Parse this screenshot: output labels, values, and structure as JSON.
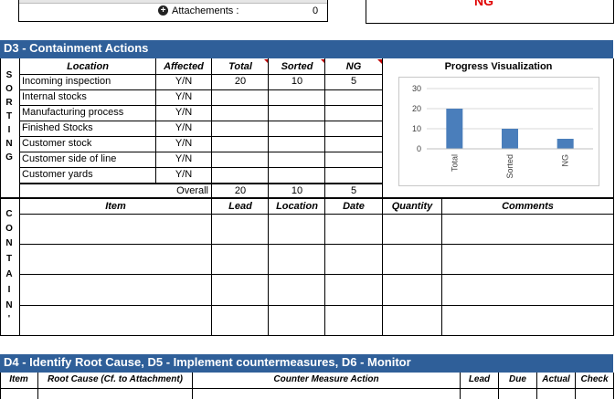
{
  "top": {
    "attachments_label": "Attachements :",
    "attachments_value": "0",
    "ng_label": "NG",
    "ng_color": "#e00000"
  },
  "d3": {
    "title": "D3 - Containment Actions",
    "sorting_letters": [
      "S",
      "O",
      "R",
      "T",
      "I",
      "N",
      "G"
    ],
    "headers": {
      "location": "Location",
      "affected": "Affected",
      "total": "Total",
      "sorted": "Sorted",
      "ng": "NG",
      "progress": "Progress Visualization"
    },
    "rows": [
      {
        "location": "Incoming inspection",
        "affected": "Y/N",
        "total": "20",
        "sorted": "10",
        "ng": "5"
      },
      {
        "location": "Internal stocks",
        "affected": "Y/N",
        "total": "",
        "sorted": "",
        "ng": ""
      },
      {
        "location": "Manufacturing process",
        "affected": "Y/N",
        "total": "",
        "sorted": "",
        "ng": ""
      },
      {
        "location": "Finished Stocks",
        "affected": "Y/N",
        "total": "",
        "sorted": "",
        "ng": ""
      },
      {
        "location": "Customer stock",
        "affected": "Y/N",
        "total": "",
        "sorted": "",
        "ng": ""
      },
      {
        "location": "Customer side of line",
        "affected": "Y/N",
        "total": "",
        "sorted": "",
        "ng": ""
      },
      {
        "location": "Customer yards",
        "affected": "Y/N",
        "total": "",
        "sorted": "",
        "ng": ""
      }
    ],
    "overall": {
      "label": "Overall",
      "total": "20",
      "sorted": "10",
      "ng": "5"
    },
    "contain_letters": [
      "C",
      "O",
      "N",
      "T",
      "A",
      "I",
      "N",
      "'"
    ],
    "contain_headers": {
      "item": "Item",
      "lead": "Lead",
      "location": "Location",
      "date": "Date",
      "quantity": "Quantity",
      "comments": "Comments"
    }
  },
  "chart_data": {
    "type": "bar",
    "categories": [
      "Total",
      "Sorted",
      "NG"
    ],
    "values": [
      20,
      10,
      5
    ],
    "ylim": [
      0,
      30
    ],
    "yticks": [
      0,
      10,
      20,
      30
    ],
    "grid": true,
    "bar_color": "#4a7ebb"
  },
  "d4": {
    "title": "D4 - Identify Root Cause, D5 - Implement countermeasures, D6 - Monitor",
    "headers": {
      "item": "Item",
      "root_cause": "Root Cause (Cf. to Attachment)",
      "counter_measure": "Counter Measure Action",
      "lead": "Lead",
      "due": "Due",
      "actual": "Actual",
      "check": "Check"
    }
  }
}
